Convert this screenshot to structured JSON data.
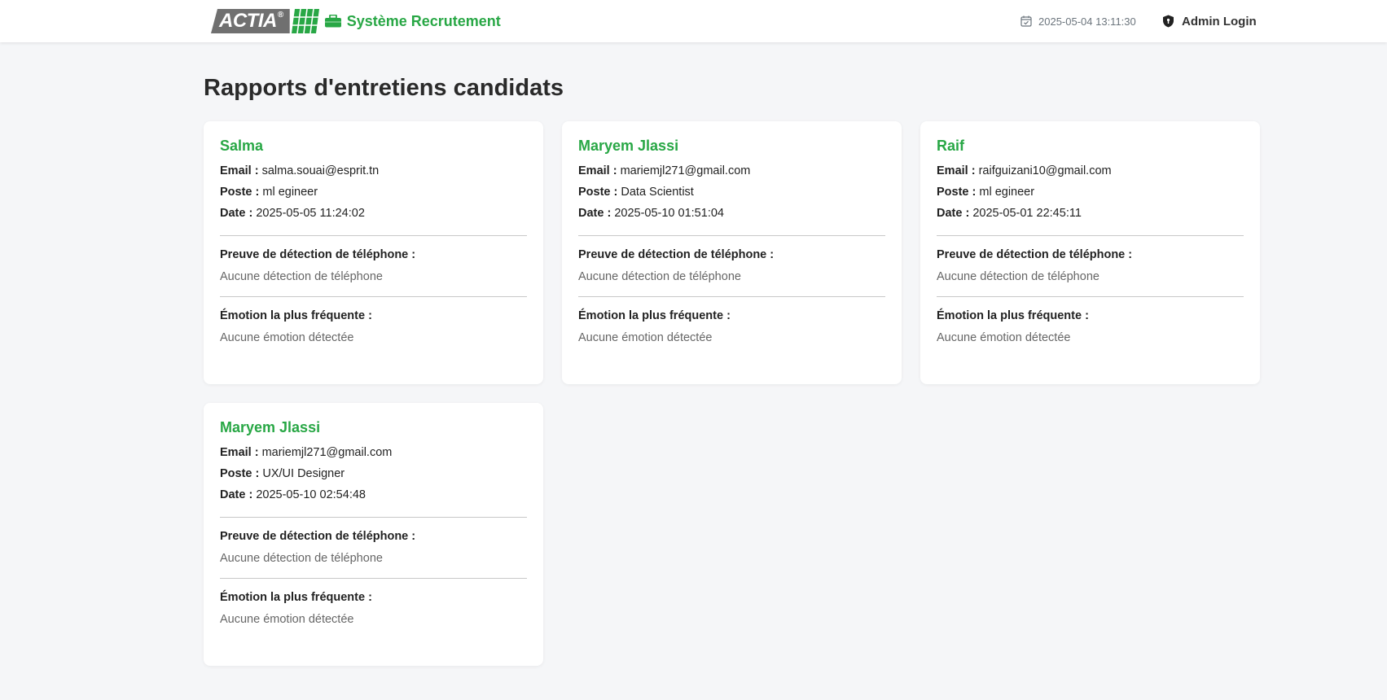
{
  "header": {
    "logo_text": "ACTIA",
    "logo_reg": "®",
    "brand_title": "Système Recrutement",
    "datetime": "2025-05-04 13:11:30",
    "admin_label": "Admin Login",
    "brand_color": "#28a745"
  },
  "main": {
    "title": "Rapports d'entretiens candidats"
  },
  "labels": {
    "email": "Email :",
    "poste": "Poste :",
    "date": "Date :",
    "phone_section": "Preuve de détection de téléphone :",
    "emotion_section": "Émotion la plus fréquente :"
  },
  "reports": [
    {
      "name": "Salma",
      "email": "salma.souai@esprit.tn",
      "poste": "ml egineer",
      "date": "2025-05-05 11:24:02",
      "phone_detection": "Aucune détection de téléphone",
      "emotion": "Aucune émotion détectée"
    },
    {
      "name": "Maryem Jlassi",
      "email": "mariemjl271@gmail.com",
      "poste": "Data Scientist",
      "date": "2025-05-10 01:51:04",
      "phone_detection": "Aucune détection de téléphone",
      "emotion": "Aucune émotion détectée"
    },
    {
      "name": "Raif",
      "email": "raifguizani10@gmail.com",
      "poste": "ml egineer",
      "date": "2025-05-01 22:45:11",
      "phone_detection": "Aucune détection de téléphone",
      "emotion": "Aucune émotion détectée"
    },
    {
      "name": "Maryem Jlassi",
      "email": "mariemjl271@gmail.com",
      "poste": "UX/UI Designer",
      "date": "2025-05-10 02:54:48",
      "phone_detection": "Aucune détection de téléphone",
      "emotion": "Aucune émotion détectée"
    }
  ]
}
